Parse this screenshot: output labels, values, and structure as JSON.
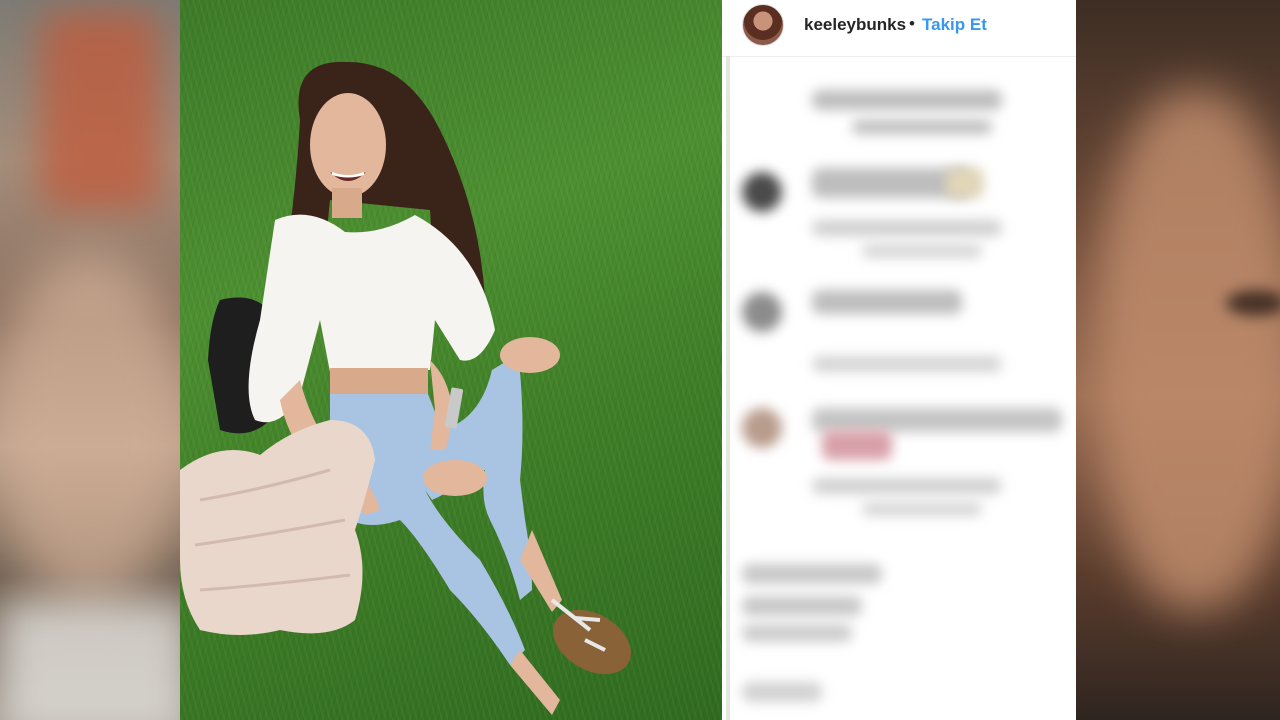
{
  "post": {
    "username": "keeleybunks",
    "separator": "•",
    "follow_label": "Takip Et"
  },
  "colors": {
    "follow_blue": "#3897f0",
    "username_text": "#262626",
    "card_background": "#ffffff"
  },
  "icons": [
    "profile-avatar"
  ]
}
